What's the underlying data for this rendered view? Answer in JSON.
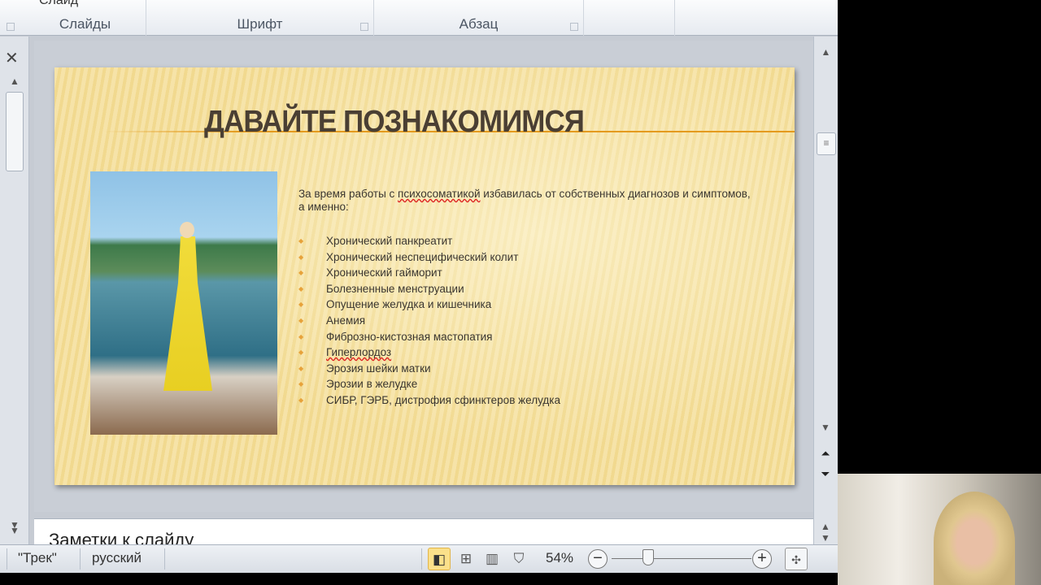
{
  "ribbon": {
    "slide_button": "Слайд",
    "groups": [
      "Слайды",
      "Шрифт",
      "Абзац"
    ]
  },
  "slide": {
    "title": "ДАВАЙТЕ ПОЗНАКОМИМСЯ",
    "intro_pre": "За время работы с ",
    "intro_err": "психосоматикой",
    "intro_post": " избавилась от собственных диагнозов и симптомов, а именно:",
    "items": [
      "Хронический панкреатит",
      "Хронический неспецифический колит",
      "Хронический гайморит",
      "Болезненные менструации",
      "Опущение желудка и кишечника",
      "Анемия",
      "Фиброзно-кистозная мастопатия",
      "Гиперлордоз",
      "Эрозия шейки матки",
      "Эрозии в желудке",
      "СИБР, ГЭРБ, дистрофия сфинктеров желудка"
    ]
  },
  "notes": {
    "placeholder": "Заметки к слайду"
  },
  "status": {
    "theme": "\"Трек\"",
    "language": "русский",
    "zoom": "54%"
  },
  "colors": {
    "accent": "#e49a1e",
    "title": "#4a3f33"
  }
}
